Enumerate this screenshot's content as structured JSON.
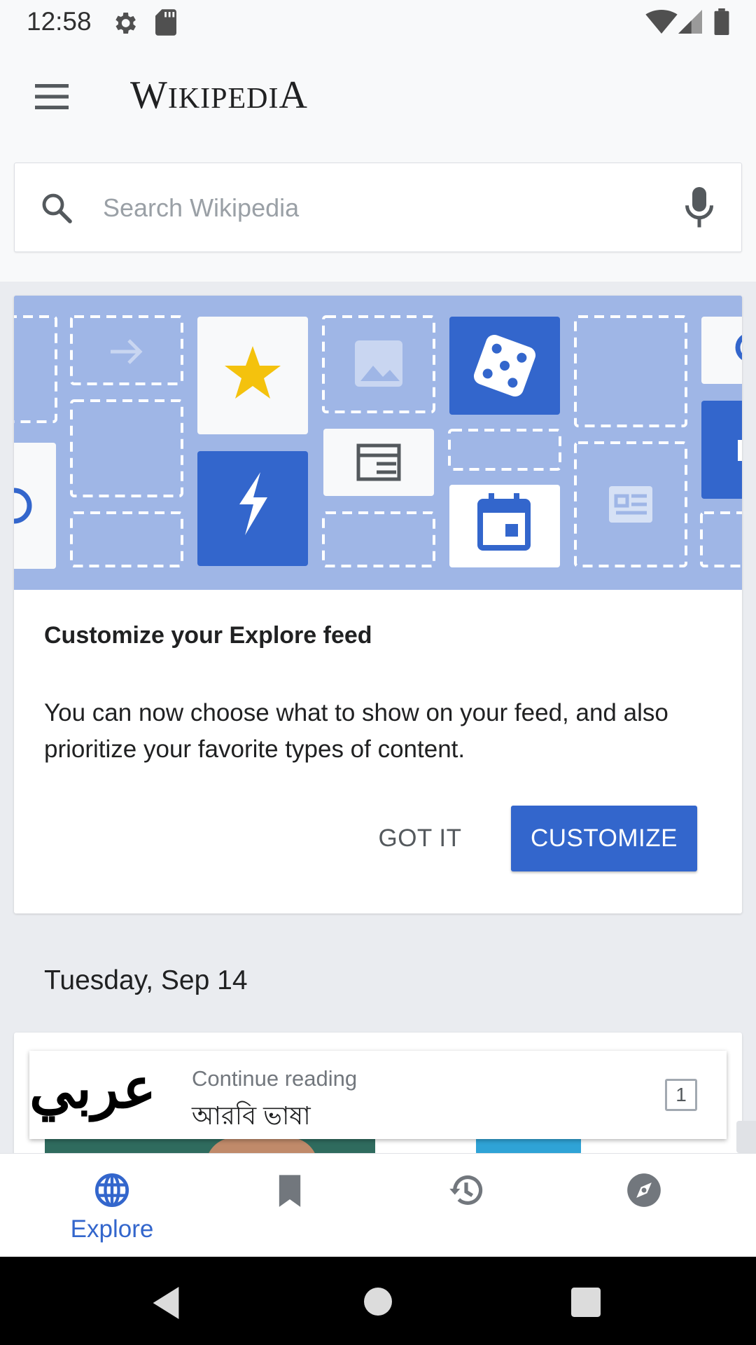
{
  "status_bar": {
    "time": "12:58"
  },
  "app_bar": {
    "logo_first": "W",
    "logo_mid": "IKIPEDI",
    "logo_last": "A"
  },
  "search": {
    "placeholder": "Search Wikipedia",
    "value": ""
  },
  "customize_card": {
    "title": "Customize your Explore feed",
    "body": "You can now choose what to show on your feed, and also prioritize your favorite types of content.",
    "dismiss_label": "GOT IT",
    "action_label": "CUSTOMIZE"
  },
  "feed": {
    "date": "Tuesday, Sep 14"
  },
  "continue_reading": {
    "label": "Continue reading",
    "title": "আরবি ভাষা",
    "thumb_text": "عربي",
    "tab_count": "1"
  },
  "bottom_nav": {
    "items": [
      {
        "icon": "globe-icon",
        "label": "Explore",
        "active": true
      },
      {
        "icon": "bookmark-icon",
        "label": "",
        "active": false
      },
      {
        "icon": "history-icon",
        "label": "",
        "active": false
      },
      {
        "icon": "compass-icon",
        "label": "",
        "active": false
      }
    ]
  },
  "colors": {
    "accent": "#3366cc",
    "illustration_bg": "#9fb6e6",
    "tile_dark": "#3366cc",
    "tile_light": "#f8f9fa",
    "star": "#f4c20d"
  }
}
